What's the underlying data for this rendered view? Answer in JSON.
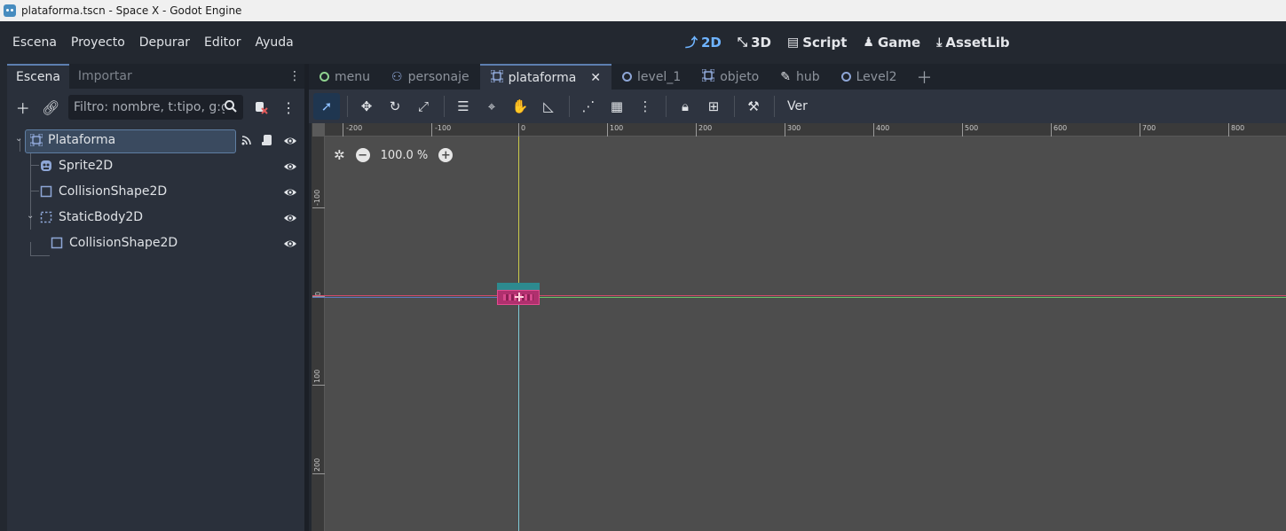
{
  "window": {
    "title": "plataforma.tscn - Space X - Godot Engine"
  },
  "menubar": {
    "menus": [
      "Escena",
      "Proyecto",
      "Depurar",
      "Editor",
      "Ayuda"
    ],
    "workspaces": [
      {
        "label": "2D",
        "icon": "2d-icon",
        "active": true
      },
      {
        "label": "3D",
        "icon": "3d-icon",
        "active": false
      },
      {
        "label": "Script",
        "icon": "script-icon",
        "active": false
      },
      {
        "label": "Game",
        "icon": "game-icon",
        "active": false
      },
      {
        "label": "AssetLib",
        "icon": "assetlib-icon",
        "active": false
      }
    ]
  },
  "dock": {
    "tabs": [
      "Escena",
      "Importar"
    ],
    "filter_placeholder": "Filtro: nombre, t:tipo, g:grupo",
    "tree": [
      {
        "label": "Plataforma",
        "icon": "node2d-icon",
        "selected": true
      },
      {
        "label": "Sprite2D",
        "icon": "sprite2d-icon"
      },
      {
        "label": "CollisionShape2D",
        "icon": "collisionshape2d-icon"
      },
      {
        "label": "StaticBody2D",
        "icon": "staticbody2d-icon"
      },
      {
        "label": "CollisionShape2D",
        "icon": "collisionshape2d-icon"
      }
    ]
  },
  "scene_tabs": [
    {
      "label": "menu",
      "icon": "node-icon"
    },
    {
      "label": "personaje",
      "icon": "character-icon"
    },
    {
      "label": "plataforma",
      "icon": "node2d-icon",
      "active": true
    },
    {
      "label": "level_1",
      "icon": "node-icon"
    },
    {
      "label": "objeto",
      "icon": "node2d-icon"
    },
    {
      "label": "hub",
      "icon": "canvas-icon"
    },
    {
      "label": "Level2",
      "icon": "node-icon"
    }
  ],
  "editor": {
    "view_menu": "Ver",
    "zoom": "100.0 %",
    "ruler_top": [
      "-200",
      "-100",
      "0",
      "100",
      "200",
      "300",
      "400",
      "500",
      "600",
      "700",
      "800"
    ],
    "ruler_left": [
      "-100",
      "0",
      "100",
      "200"
    ]
  },
  "colors": {
    "accent": "#6fb4ff",
    "axis_x": "#d14a6a",
    "axis_y": "#c8c84a",
    "platform": "#b0306e"
  }
}
